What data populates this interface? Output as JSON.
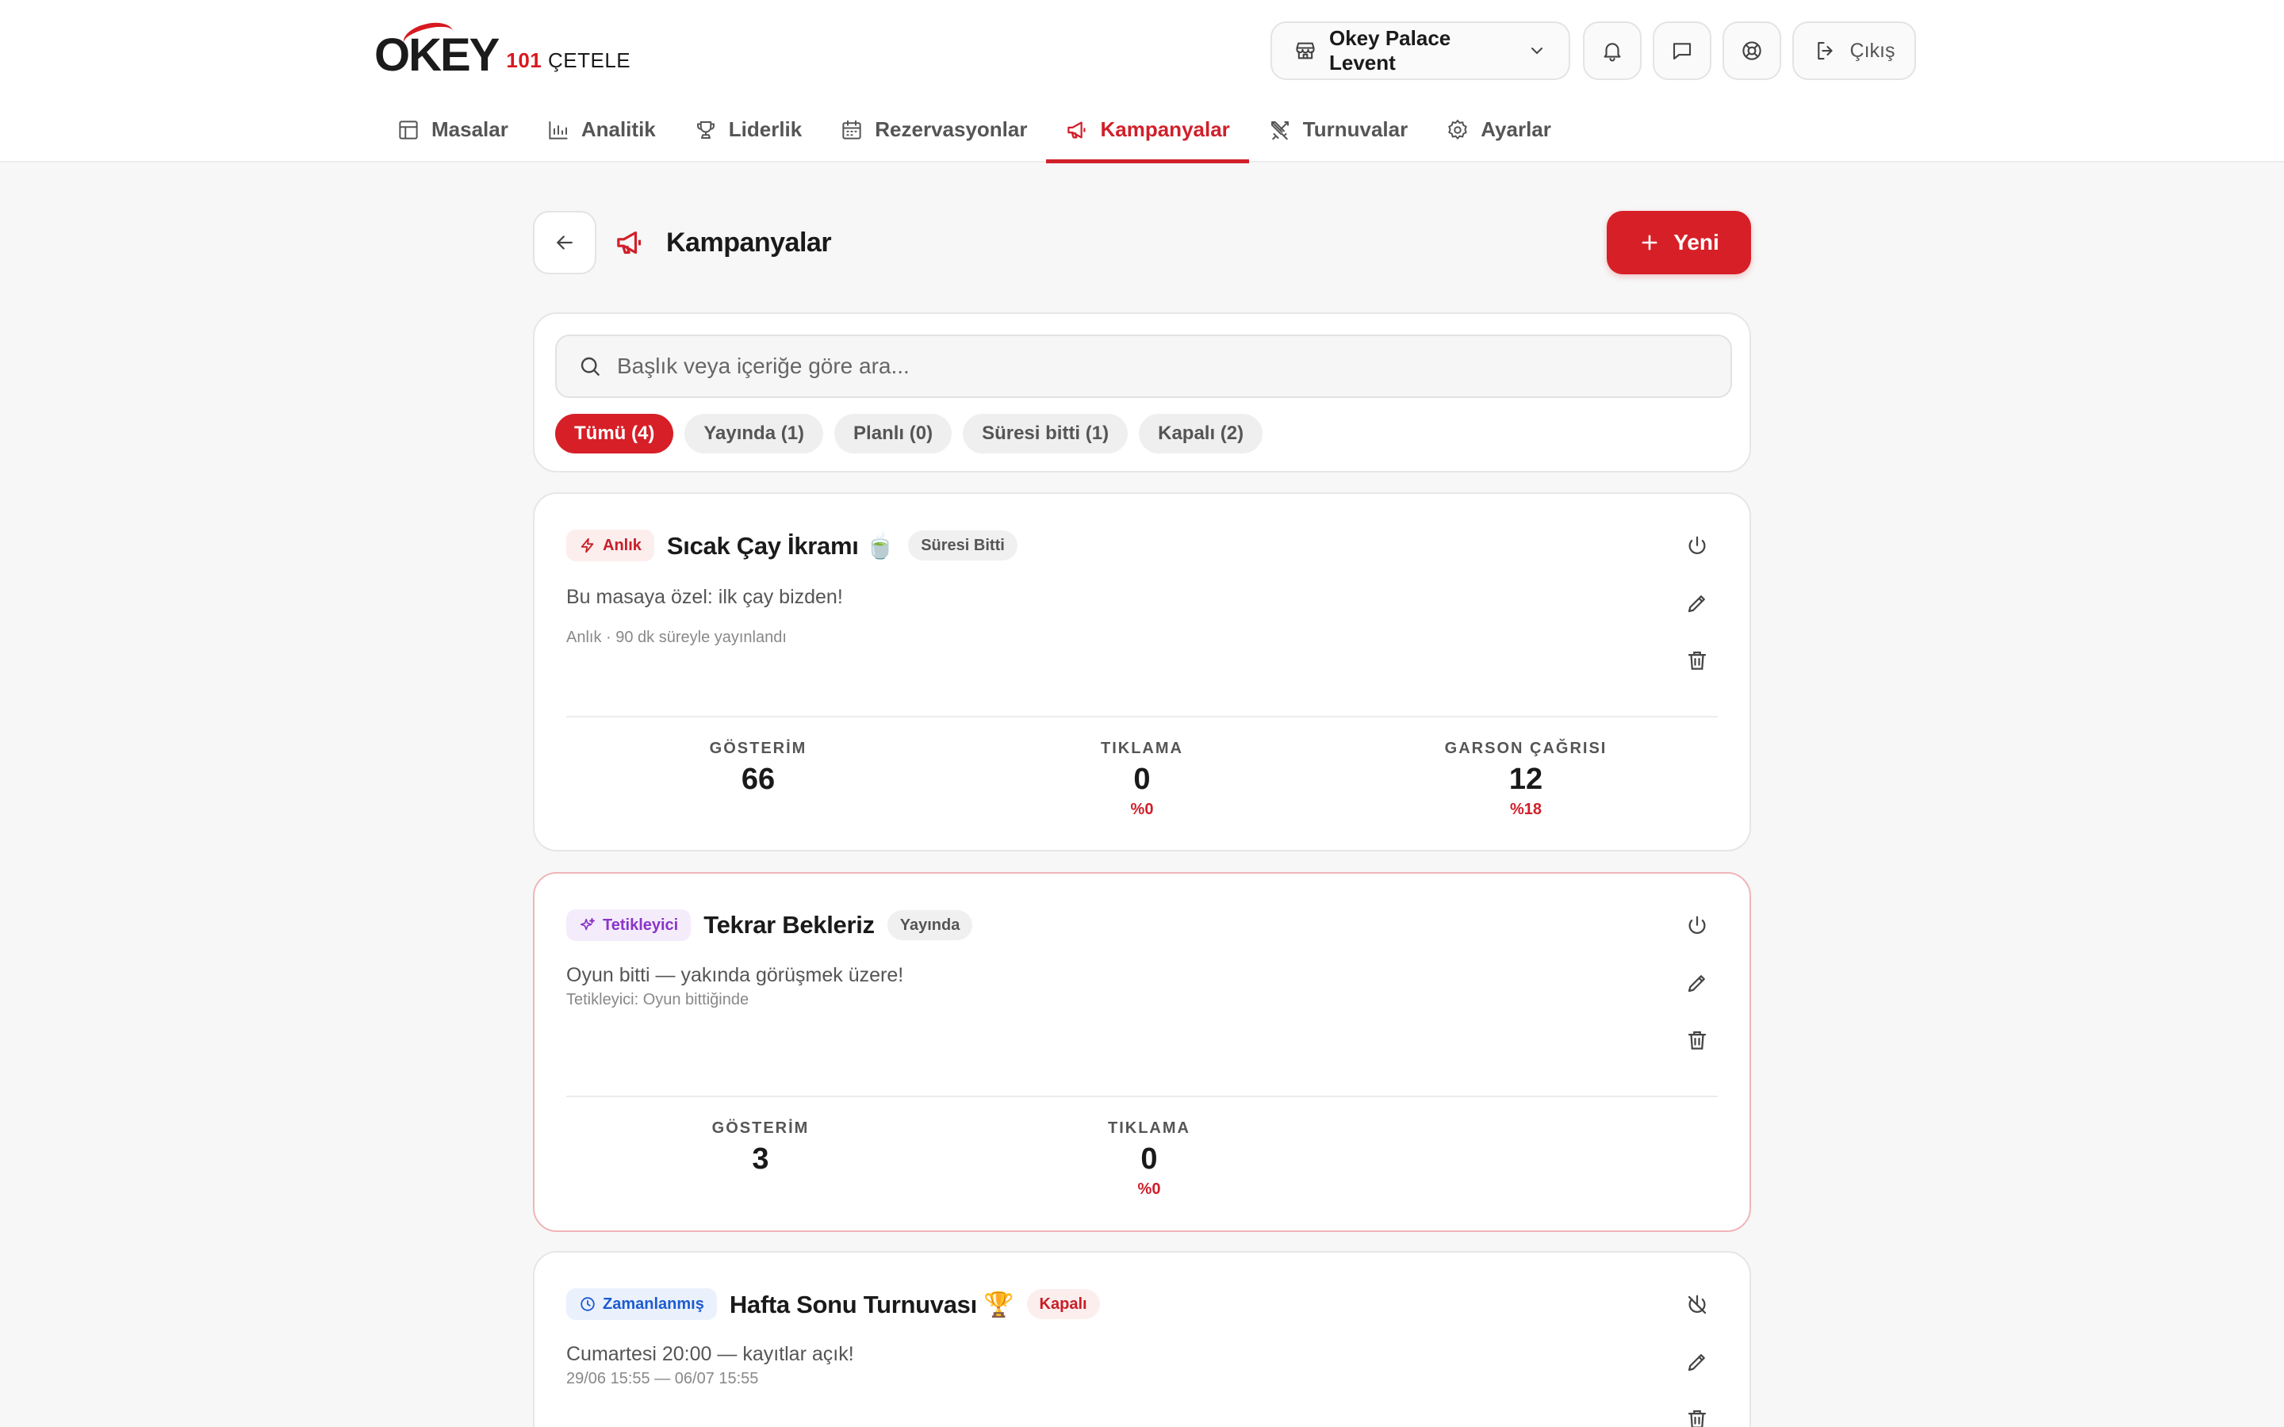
{
  "brand": {
    "logo_main": "OKEY",
    "logo_sub_mark": "101",
    "logo_sub": "ÇETELE"
  },
  "header": {
    "venue": "Okey Palace Levent",
    "logout_label": "Çıkış"
  },
  "nav": {
    "tabs": [
      {
        "label": "Masalar",
        "icon": "table-icon"
      },
      {
        "label": "Analitik",
        "icon": "chart-icon"
      },
      {
        "label": "Liderlik",
        "icon": "trophy-icon"
      },
      {
        "label": "Rezervasyonlar",
        "icon": "calendar-icon"
      },
      {
        "label": "Kampanyalar",
        "icon": "megaphone-icon",
        "active": true
      },
      {
        "label": "Turnuvalar",
        "icon": "swords-icon"
      },
      {
        "label": "Ayarlar",
        "icon": "gear-icon"
      }
    ]
  },
  "page": {
    "title": "Kampanyalar",
    "new_label": "Yeni"
  },
  "search": {
    "placeholder": "Başlık veya içeriğe göre ara..."
  },
  "filters": [
    {
      "label": "Tümü (4)",
      "active": true
    },
    {
      "label": "Yayında (1)"
    },
    {
      "label": "Planlı (0)"
    },
    {
      "label": "Süresi bitti (1)"
    },
    {
      "label": "Kapalı (2)"
    }
  ],
  "campaigns": [
    {
      "type": "Anlık",
      "title": "Sıcak Çay İkramı",
      "emoji": "🍵",
      "status": "Süresi Bitti",
      "description": "Bu masaya özel: ilk çay bizden!",
      "meta": "Anlık · 90 dk süreyle yayınlandı",
      "stats": [
        {
          "label": "GÖSTERİM",
          "value": "66",
          "pct": ""
        },
        {
          "label": "TIKLAMA",
          "value": "0",
          "pct": "%0"
        },
        {
          "label": "GARSON ÇAĞRISI",
          "value": "12",
          "pct": "%18"
        }
      ]
    },
    {
      "type": "Tetikleyici",
      "title": "Tekrar Bekleriz",
      "status": "Yayında",
      "description": "Oyun bitti — yakında görüşmek üzere!",
      "meta": "Tetikleyici: Oyun bittiğinde",
      "stats": [
        {
          "label": "GÖSTERİM",
          "value": "3",
          "pct": ""
        },
        {
          "label": "TIKLAMA",
          "value": "0",
          "pct": "%0"
        }
      ]
    },
    {
      "type": "Zamanlanmış",
      "title": "Hafta Sonu Turnuvası",
      "emoji": "🏆",
      "status": "Kapalı",
      "description": "Cumartesi 20:00 — kayıtlar açık!",
      "meta": "29/06 15:55 — 06/07 15:55"
    }
  ],
  "colors": {
    "accent": "#d71f27",
    "purple": "#8a35c9",
    "blue": "#1d5bd0"
  }
}
